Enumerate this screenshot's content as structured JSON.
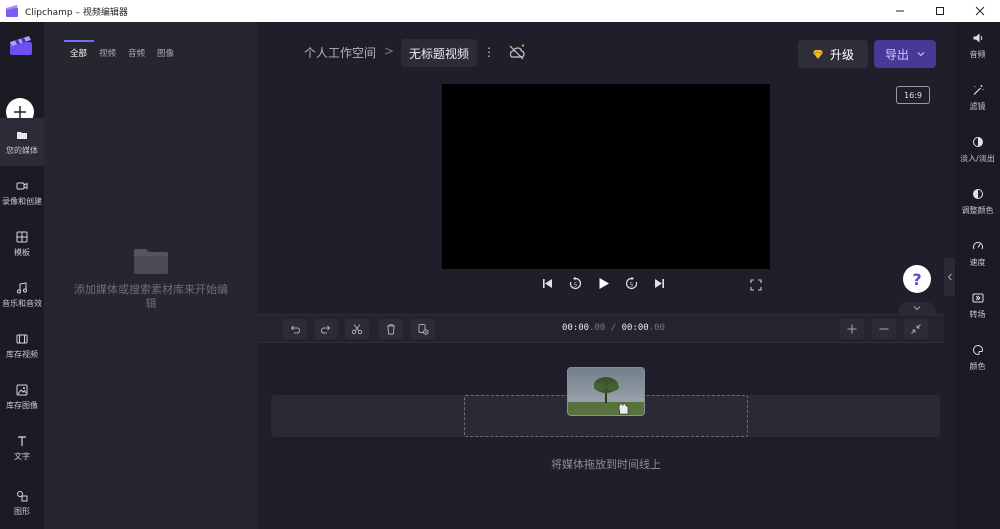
{
  "window": {
    "title": "Clipchamp – 视频编辑器",
    "controls": [
      "minimize",
      "maximize",
      "close"
    ]
  },
  "nav": {
    "items": [
      {
        "label": "您的媒体",
        "icon": "folder-icon",
        "active": true
      },
      {
        "label": "录像和创建",
        "icon": "video-camera-icon",
        "active": false
      },
      {
        "label": "模板",
        "icon": "templates-icon",
        "active": false
      },
      {
        "label": "音乐和音效",
        "icon": "music-icon",
        "active": false
      },
      {
        "label": "库存视频",
        "icon": "film-icon",
        "active": false
      },
      {
        "label": "库存图像",
        "icon": "image-icon",
        "active": false
      },
      {
        "label": "文字",
        "icon": "text-icon",
        "active": false
      },
      {
        "label": "图形",
        "icon": "shapes-icon",
        "active": false
      }
    ]
  },
  "media": {
    "tabs": [
      "全部",
      "视频",
      "音频",
      "图像"
    ],
    "active_tab": "全部",
    "empty_message": "添加媒体或搜索素材库来开始编辑"
  },
  "header": {
    "workspace": "个人工作空间",
    "separator": ">",
    "video_title": "无标题视频",
    "upgrade_label": "升级",
    "export_label": "导出"
  },
  "preview": {
    "aspect_ratio": "16:9"
  },
  "timeline": {
    "current_time": "00:00",
    "current_frac": ".00",
    "divider": " / ",
    "total_time": "00:00",
    "total_frac": ".00",
    "drop_hint": "将媒体拖放到时间线上"
  },
  "right_panel": {
    "items": [
      {
        "label": "音频",
        "icon": "speaker-icon"
      },
      {
        "label": "滤镜",
        "icon": "magic-wand-icon"
      },
      {
        "label": "淡入/淡出",
        "icon": "fade-icon"
      },
      {
        "label": "调整颜色",
        "icon": "color-adjust-icon"
      },
      {
        "label": "速度",
        "icon": "speedometer-icon"
      },
      {
        "label": "转场",
        "icon": "transition-icon"
      },
      {
        "label": "颜色",
        "icon": "palette-icon"
      }
    ]
  },
  "colors": {
    "accent": "#7a6cf0",
    "export_bg": "#463a96",
    "background": "#1f1f2b"
  }
}
